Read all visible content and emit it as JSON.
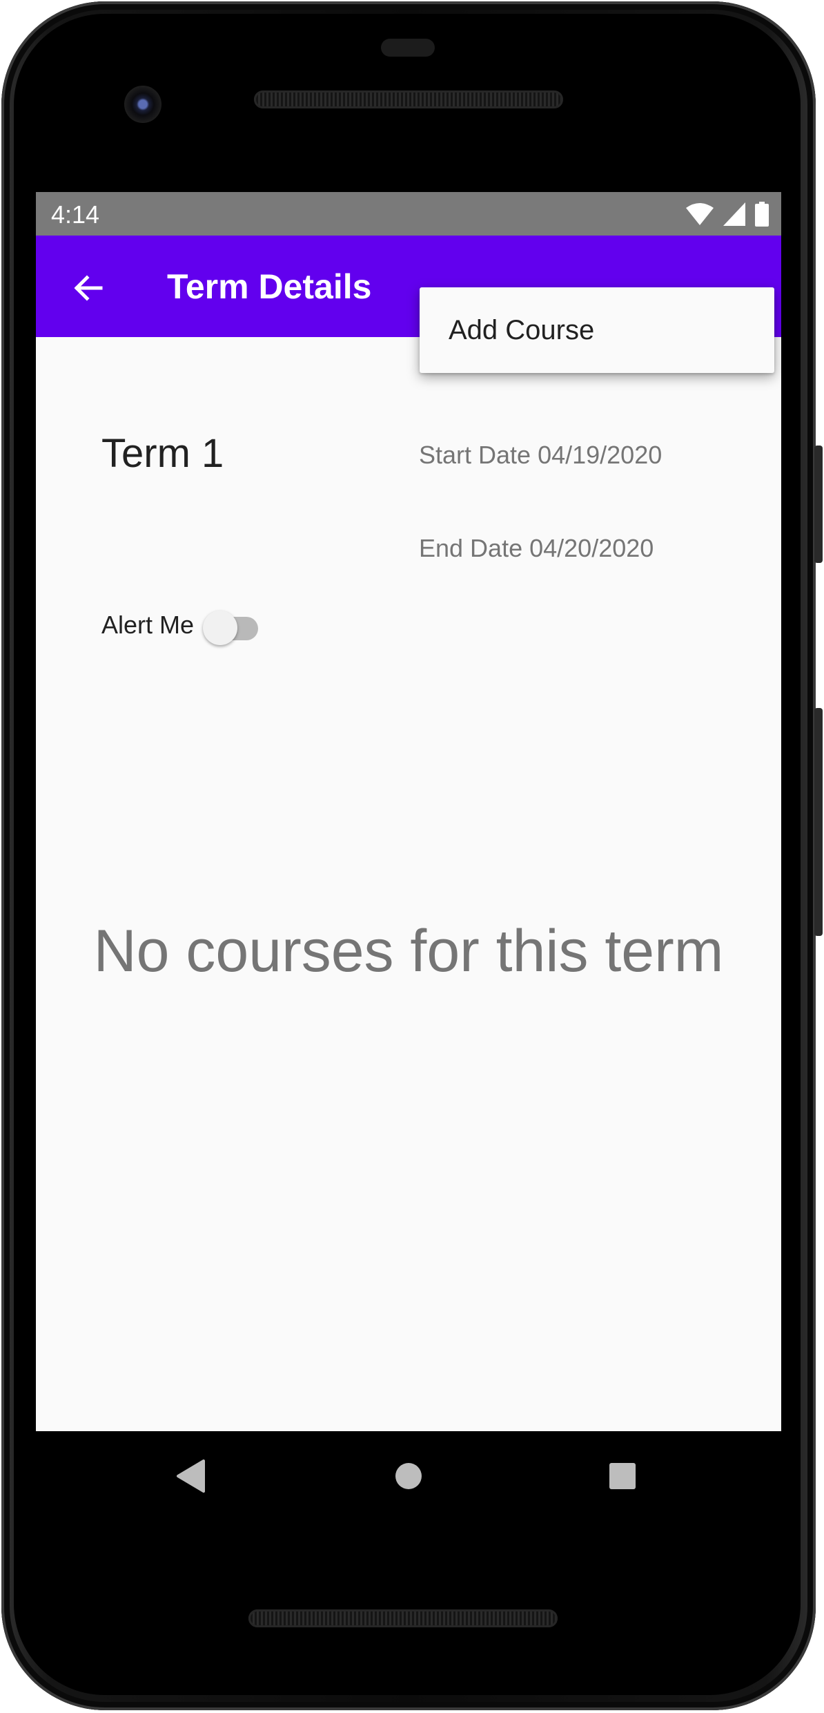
{
  "status_bar": {
    "time": "4:14",
    "icons": [
      "wifi-icon",
      "signal-icon",
      "battery-icon"
    ]
  },
  "app_bar": {
    "back_icon": "arrow-left-icon",
    "title": "Term Details",
    "background_color": "#6200ee"
  },
  "overflow_menu": {
    "items": [
      {
        "label": "Add Course"
      }
    ]
  },
  "term": {
    "name": "Term 1",
    "start_date": "Start Date 04/19/2020",
    "end_date": "End Date 04/20/2020"
  },
  "alert": {
    "label": "Alert Me",
    "enabled": false
  },
  "courses": {
    "empty_message": "No courses for this term"
  },
  "navigation_bar": {
    "buttons": [
      "back-triangle-icon",
      "home-circle-icon",
      "recents-square-icon"
    ]
  }
}
